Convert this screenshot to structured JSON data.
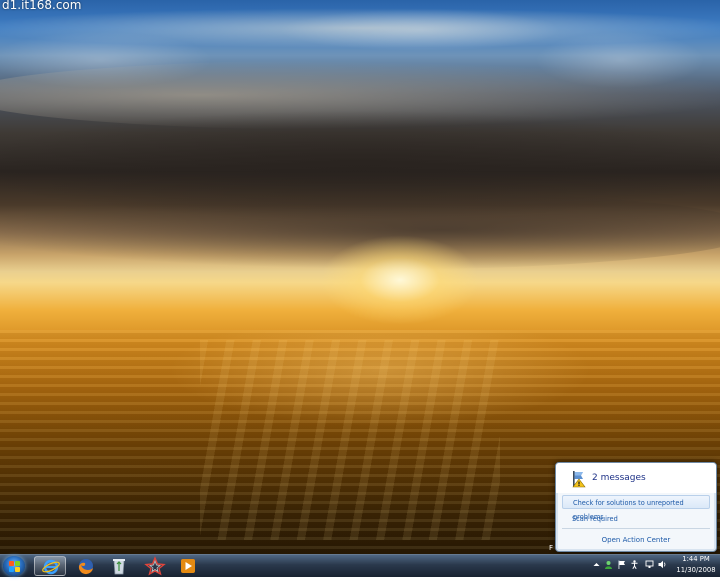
{
  "desktop": {
    "watermark": "d1.it168.com"
  },
  "action_center": {
    "title": "2 messages",
    "items": [
      {
        "label": "Check for solutions to unreported problems"
      },
      {
        "label": "Scan required"
      }
    ],
    "footer": "Open Action Center",
    "stub_label": "F"
  },
  "taskbar": {
    "pinned": [
      {
        "name": "internet-explorer",
        "icon": "ie-icon",
        "active": true
      },
      {
        "name": "firefox",
        "icon": "firefox-icon",
        "active": false
      },
      {
        "name": "recycle-bin",
        "icon": "recycle-bin-icon",
        "active": false
      },
      {
        "name": "paint-app",
        "icon": "star-app-icon",
        "active": false
      },
      {
        "name": "media-player",
        "icon": "media-player-icon",
        "active": false
      }
    ],
    "clock": {
      "time": "1:44 PM",
      "date": "11/30/2008"
    }
  },
  "colors": {
    "link": "#1e5aa8",
    "title": "#1e3287"
  }
}
